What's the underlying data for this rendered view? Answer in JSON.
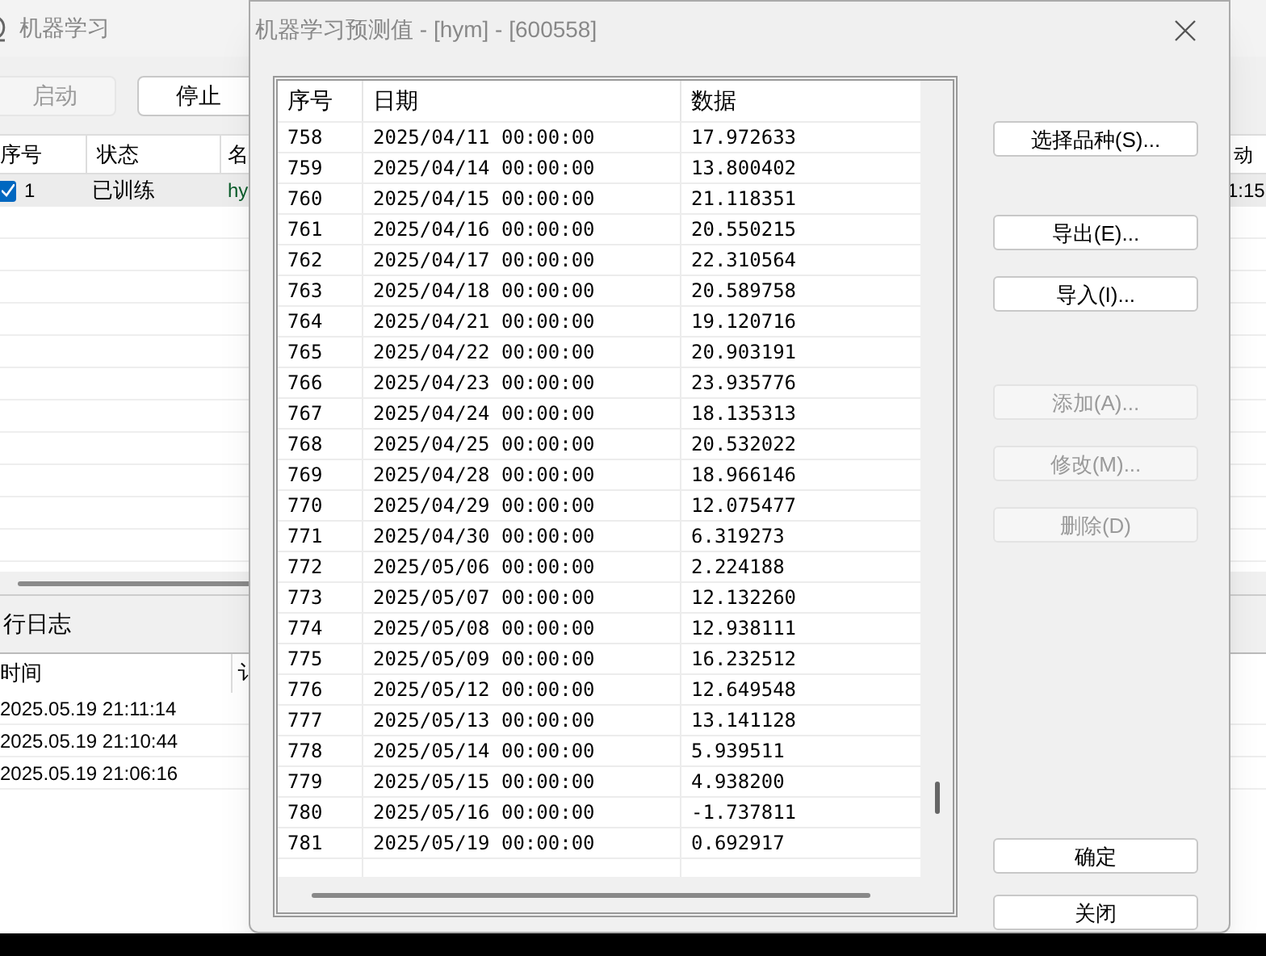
{
  "main_window": {
    "title": "机器学习",
    "buttons": [
      {
        "label": "启动",
        "disabled": true
      },
      {
        "label": "停止",
        "disabled": false
      }
    ],
    "table": {
      "columns": [
        "序号",
        "状态",
        "名"
      ],
      "right_header": "动",
      "rows": [
        {
          "checked": true,
          "index": "1",
          "status": "已训练",
          "name": "hy",
          "time": "1:15"
        }
      ]
    },
    "log": {
      "title": "行日志",
      "columns": [
        "时间",
        "讠"
      ],
      "rows": [
        {
          "time": "2025.05.19 21:11:14"
        },
        {
          "time": "2025.05.19 21:10:44"
        },
        {
          "time": "2025.05.19 21:06:16"
        }
      ]
    }
  },
  "dialog": {
    "title": "机器学习预测值 - [hym] - [600558]",
    "columns": [
      "序号",
      "日期",
      "数据"
    ],
    "rows": [
      [
        "758",
        "2025/04/11 00:00:00",
        "17.972633"
      ],
      [
        "759",
        "2025/04/14 00:00:00",
        "13.800402"
      ],
      [
        "760",
        "2025/04/15 00:00:00",
        "21.118351"
      ],
      [
        "761",
        "2025/04/16 00:00:00",
        "20.550215"
      ],
      [
        "762",
        "2025/04/17 00:00:00",
        "22.310564"
      ],
      [
        "763",
        "2025/04/18 00:00:00",
        "20.589758"
      ],
      [
        "764",
        "2025/04/21 00:00:00",
        "19.120716"
      ],
      [
        "765",
        "2025/04/22 00:00:00",
        "20.903191"
      ],
      [
        "766",
        "2025/04/23 00:00:00",
        "23.935776"
      ],
      [
        "767",
        "2025/04/24 00:00:00",
        "18.135313"
      ],
      [
        "768",
        "2025/04/25 00:00:00",
        "20.532022"
      ],
      [
        "769",
        "2025/04/28 00:00:00",
        "18.966146"
      ],
      [
        "770",
        "2025/04/29 00:00:00",
        "12.075477"
      ],
      [
        "771",
        "2025/04/30 00:00:00",
        "6.319273"
      ],
      [
        "772",
        "2025/05/06 00:00:00",
        "2.224188"
      ],
      [
        "773",
        "2025/05/07 00:00:00",
        "12.132260"
      ],
      [
        "774",
        "2025/05/08 00:00:00",
        "12.938111"
      ],
      [
        "775",
        "2025/05/09 00:00:00",
        "16.232512"
      ],
      [
        "776",
        "2025/05/12 00:00:00",
        "12.649548"
      ],
      [
        "777",
        "2025/05/13 00:00:00",
        "13.141128"
      ],
      [
        "778",
        "2025/05/14 00:00:00",
        "5.939511"
      ],
      [
        "779",
        "2025/05/15 00:00:00",
        "4.938200"
      ],
      [
        "780",
        "2025/05/16 00:00:00",
        "-1.737811"
      ],
      [
        "781",
        "2025/05/19 00:00:00",
        "0.692917"
      ]
    ],
    "buttons": [
      {
        "label": "选择品种(S)...",
        "disabled": false
      },
      {
        "label": "导出(E)...",
        "disabled": false
      },
      {
        "label": "导入(I)...",
        "disabled": false
      },
      {
        "label": "添加(A)...",
        "disabled": true
      },
      {
        "label": "修改(M)...",
        "disabled": true
      },
      {
        "label": "删除(D)",
        "disabled": true
      },
      {
        "label": "确定",
        "disabled": false
      },
      {
        "label": "关闭",
        "disabled": false
      }
    ]
  }
}
